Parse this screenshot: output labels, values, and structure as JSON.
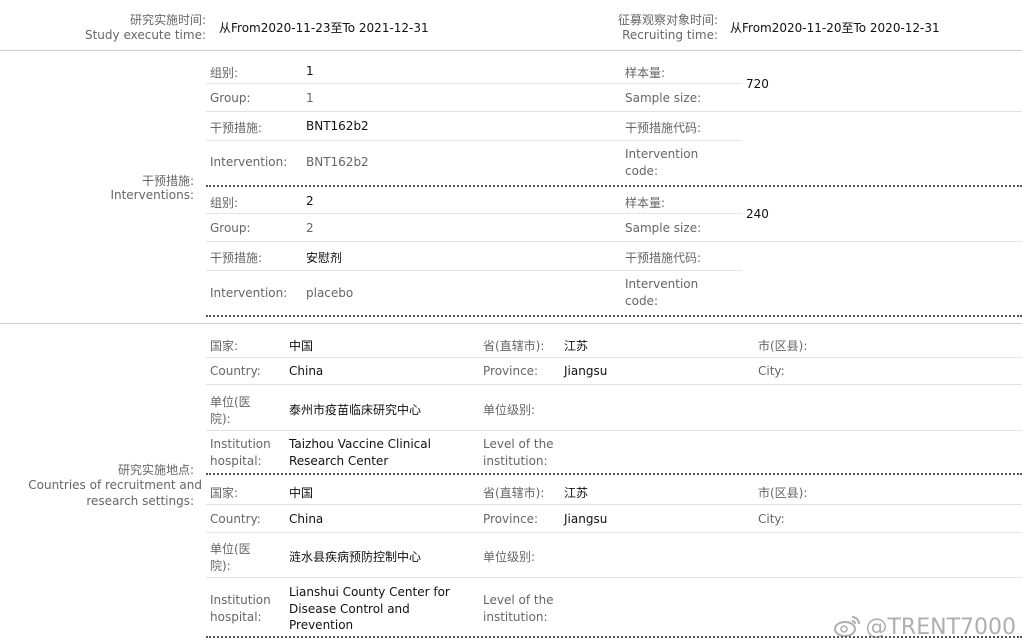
{
  "time": {
    "study_label_cn": "研究实施时间:",
    "study_label_en": "Study execute time:",
    "study_value": "从From2020-11-23至To 2021-12-31",
    "recruit_label_cn": "征募观察对象时间:",
    "recruit_label_en": "Recruiting time:",
    "recruit_value": "从From2020-11-20至To 2020-12-31"
  },
  "interventions": {
    "section_cn": "干预措施:",
    "section_en": "Interventions:",
    "labels": {
      "group_cn": "组别:",
      "group_en": "Group:",
      "interv_cn": "干预措施:",
      "interv_en": "Intervention:",
      "size_cn": "样本量:",
      "size_en": "Sample size:",
      "code_cn": "干预措施代码:",
      "code_en_1": "Intervention",
      "code_en_2": "code:"
    },
    "groups": [
      {
        "group_cn": "1",
        "group_en": "1",
        "interv_cn": "BNT162b2",
        "interv_en": "BNT162b2",
        "size": "720"
      },
      {
        "group_cn": "2",
        "group_en": "2",
        "interv_cn": "安慰剂",
        "interv_en": "placebo",
        "size": "240"
      }
    ]
  },
  "sites": {
    "section_cn": "研究实施地点:",
    "section_en_1": "Countries of recruitment and",
    "section_en_2": "research settings:",
    "labels": {
      "country_cn": "国家:",
      "country_en": "Country:",
      "province_cn": "省(直辖市):",
      "province_en": "Province:",
      "city_cn": "市(区县):",
      "city_en": "City:",
      "inst_cn_1": "单位(医",
      "inst_cn_2": "院):",
      "inst_en_1": "Institution",
      "inst_en_2": "hospital:",
      "level_cn": "单位级别:",
      "level_en_1": "Level of the",
      "level_en_2": "institution:"
    },
    "items": [
      {
        "country_cn": "中国",
        "country_en": "China",
        "province_cn": "江苏",
        "province_en": "Jiangsu",
        "inst_cn": "泰州市疫苗临床研究中心",
        "inst_en_1": "Taizhou Vaccine Clinical",
        "inst_en_2": "Research Center"
      },
      {
        "country_cn": "中国",
        "country_en": "China",
        "province_cn": "江苏",
        "province_en": "Jiangsu",
        "inst_cn": "涟水县疾病预防控制中心",
        "inst_en_1": "Lianshui County Center for",
        "inst_en_2": "Disease Control and",
        "inst_en_3": "Prevention"
      }
    ]
  },
  "watermark": "@TRENT7000"
}
